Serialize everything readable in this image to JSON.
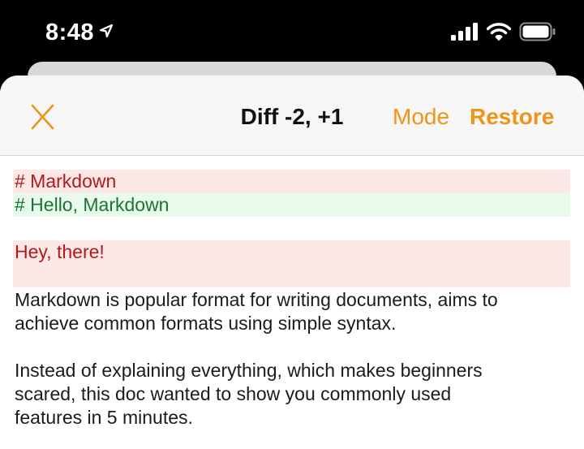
{
  "status_bar": {
    "time": "8:48",
    "icons": [
      "location-arrow-icon",
      "cellular-signal-icon",
      "wifi-icon",
      "battery-icon"
    ]
  },
  "nav": {
    "close_icon": "close-icon",
    "title": "Diff -2, +1",
    "mode_label": "Mode",
    "restore_label": "Restore"
  },
  "diff": {
    "lines": [
      {
        "type": "removed",
        "text": "# Markdown"
      },
      {
        "type": "added",
        "text": "# Hello, Markdown"
      },
      {
        "type": "removed",
        "text": "Hey, there!"
      },
      {
        "type": "plain",
        "text": "Markdown is popular format for writing documents, aims to"
      },
      {
        "type": "plain",
        "text": "achieve common formats using simple syntax."
      },
      {
        "type": "plain",
        "text": "Instead of explaining everything, which makes beginners"
      },
      {
        "type": "plain",
        "text": "scared, this doc wanted to show you commonly used"
      },
      {
        "type": "plain",
        "text": "features in 5 minutes."
      }
    ]
  },
  "colors": {
    "accent": "#f0931b",
    "removed_bg": "#fde7e7",
    "removed_text": "#b21a1a",
    "added_bg": "#e8faec",
    "added_text": "#1c7434"
  }
}
